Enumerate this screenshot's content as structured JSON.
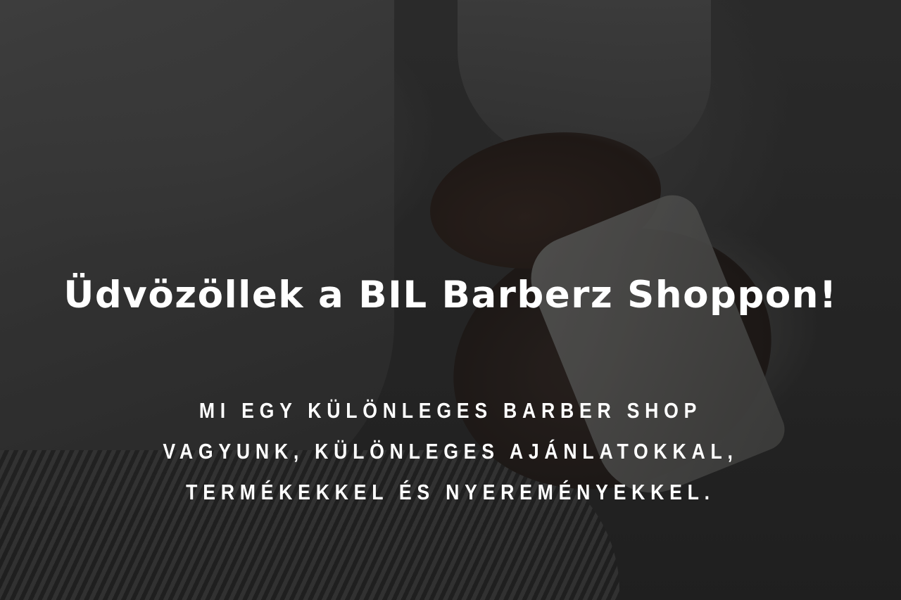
{
  "hero": {
    "background_image": "barber-shaving-customer-photo",
    "headline": "Üdvözöllek a BIL Barberz Shoppon!",
    "subheadline": "MI EGY KÜLÖNLEGES BARBER SHOP VAGYUNK, KÜLÖNLEGES AJÁNLATOKKAL, TERMÉKEKKEL ÉS NYEREMÉNYEKKEL."
  },
  "colors": {
    "text": "#ffffff",
    "overlay": "#000000"
  }
}
